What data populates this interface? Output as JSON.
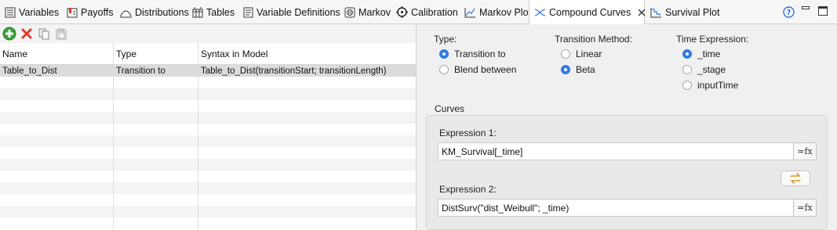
{
  "tabs": [
    {
      "label": "Variables",
      "icon": "variables-icon"
    },
    {
      "label": "Payoffs",
      "icon": "payoffs-icon"
    },
    {
      "label": "Distributions",
      "icon": "distributions-icon"
    },
    {
      "label": "Tables",
      "icon": "tables-icon"
    },
    {
      "label": "Variable Definitions",
      "icon": "variable-definitions-icon"
    },
    {
      "label": "Markov",
      "icon": "markov-icon"
    },
    {
      "label": "Calibration",
      "icon": "calibration-icon"
    },
    {
      "label": "Markov Plot",
      "icon": "markov-plot-icon"
    },
    {
      "label": "Compound Curves",
      "icon": "compound-curves-icon",
      "active": true
    },
    {
      "label": "Survival Plot",
      "icon": "survival-plot-icon"
    }
  ],
  "colors": {
    "accent": "#2f7ae5",
    "add": "#3aa23a",
    "delete": "#d93a2b",
    "selected_row": "#dcdcdc"
  },
  "table": {
    "columns": [
      "Name",
      "Type",
      "Syntax in Model"
    ],
    "rows": [
      [
        "Table_to_Dist",
        "Transition to",
        "Table_to_Dist(transitionStart; transitionLength)"
      ]
    ],
    "selected_row": 0
  },
  "form": {
    "type_label": "Type:",
    "type_options": [
      "Transition to",
      "Blend between"
    ],
    "type_selected": 0,
    "method_label": "Transition Method:",
    "method_options": [
      "Linear",
      "Beta"
    ],
    "method_selected": 1,
    "time_label": "Time Expression:",
    "time_options": [
      "_time",
      "_stage",
      "inputTime"
    ],
    "time_selected": 0,
    "curves_label": "Curves",
    "expr1_label": "Expression 1:",
    "expr1_value": "KM_Survival[_time]",
    "expr2_label": "Expression 2:",
    "expr2_value": "DistSurv(\"dist_Weibull\"; _time)",
    "fx_label": "=fx"
  }
}
